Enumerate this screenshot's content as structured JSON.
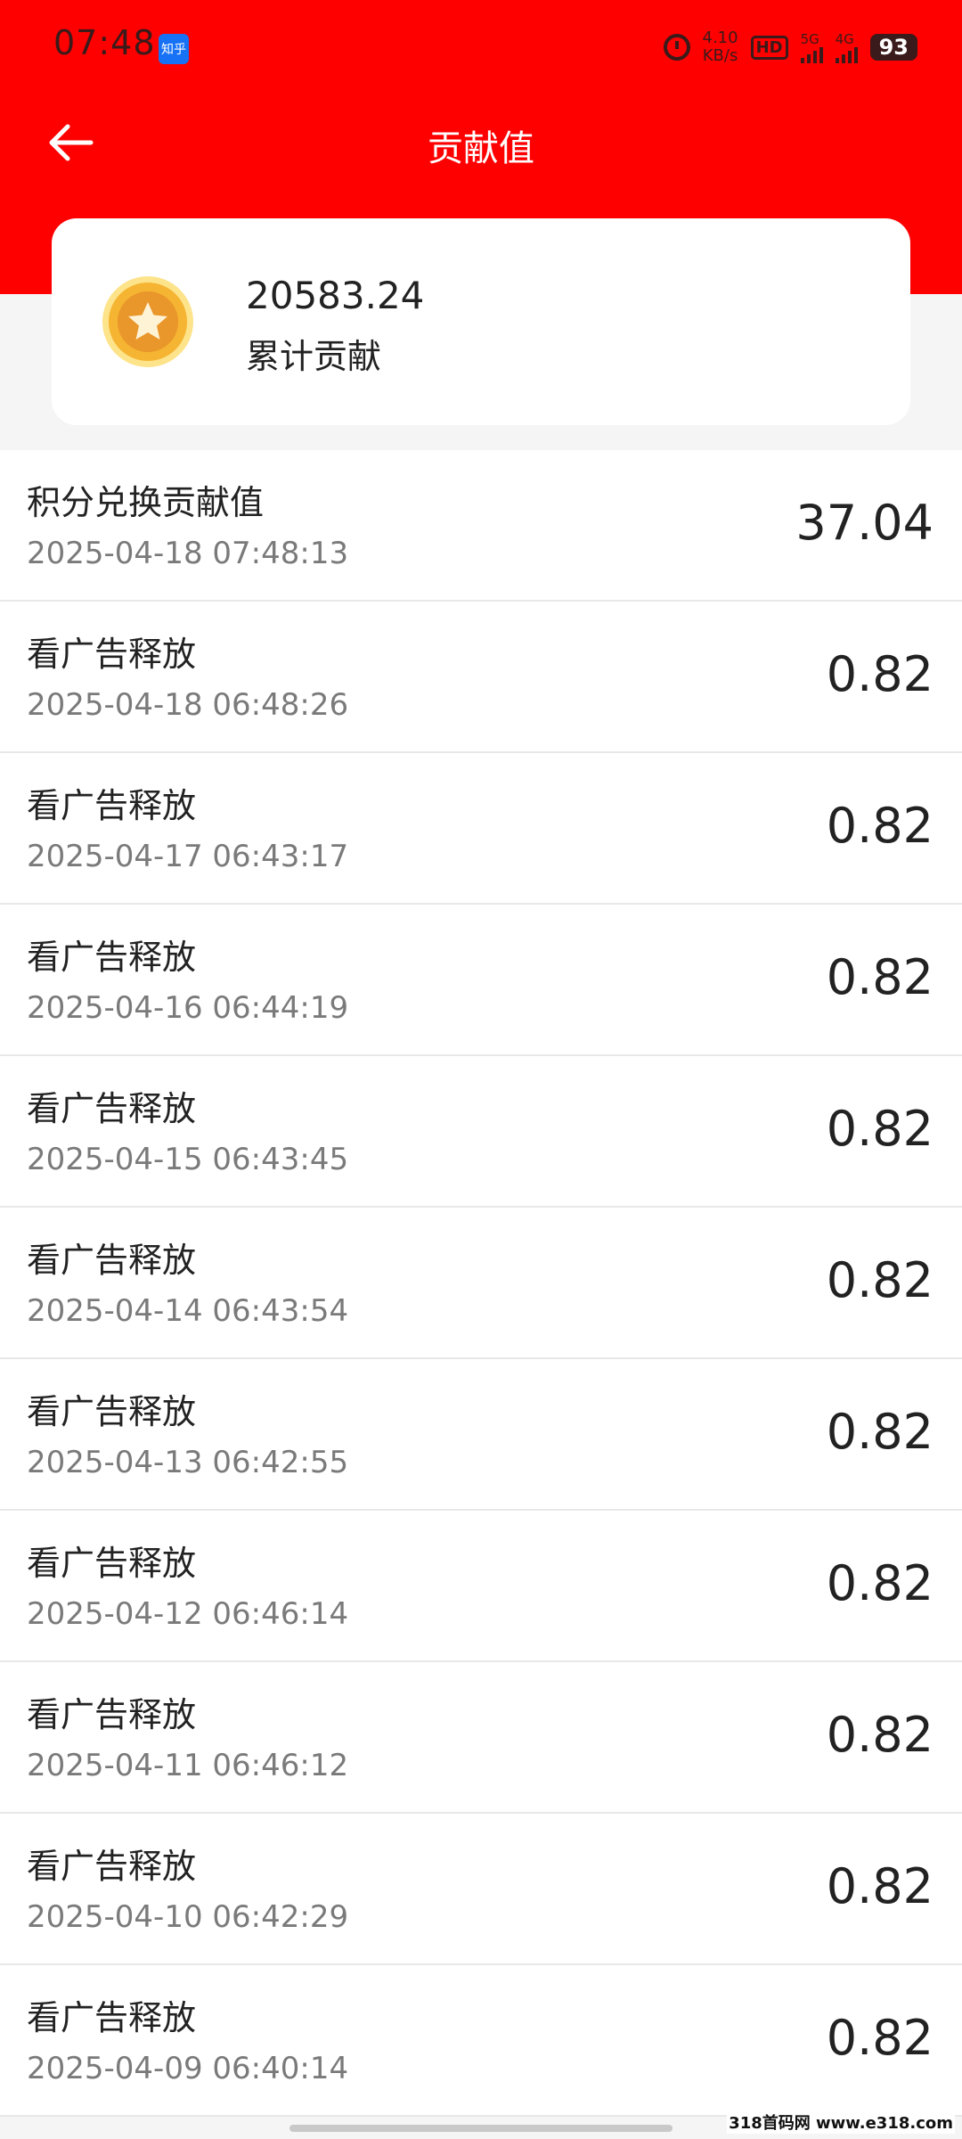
{
  "status_bar": {
    "time": "07:48",
    "app_icon_text": "知乎",
    "net_speed_value": "4.10",
    "net_speed_unit": "KB/s",
    "hd_label": "HD",
    "sim1_label": "5G",
    "sim2_label": "4G",
    "battery": "93"
  },
  "header": {
    "title": "贡献值"
  },
  "summary": {
    "value": "20583.24",
    "label": "累计贡献"
  },
  "records": [
    {
      "label": "积分兑换贡献值",
      "date": "2025-04-18 07:48:13",
      "amount": "37.04"
    },
    {
      "label": "看广告释放",
      "date": "2025-04-18 06:48:26",
      "amount": "0.82"
    },
    {
      "label": "看广告释放",
      "date": "2025-04-17 06:43:17",
      "amount": "0.82"
    },
    {
      "label": "看广告释放",
      "date": "2025-04-16 06:44:19",
      "amount": "0.82"
    },
    {
      "label": "看广告释放",
      "date": "2025-04-15 06:43:45",
      "amount": "0.82"
    },
    {
      "label": "看广告释放",
      "date": "2025-04-14 06:43:54",
      "amount": "0.82"
    },
    {
      "label": "看广告释放",
      "date": "2025-04-13 06:42:55",
      "amount": "0.82"
    },
    {
      "label": "看广告释放",
      "date": "2025-04-12 06:46:14",
      "amount": "0.82"
    },
    {
      "label": "看广告释放",
      "date": "2025-04-11 06:46:12",
      "amount": "0.82"
    },
    {
      "label": "看广告释放",
      "date": "2025-04-10 06:42:29",
      "amount": "0.82"
    },
    {
      "label": "看广告释放",
      "date": "2025-04-09 06:40:14",
      "amount": "0.82"
    }
  ],
  "watermark": "318首码网 www.e318.com",
  "colors": {
    "header_red": "#ff0000",
    "page_bg": "#f5f5f5",
    "coin_gold": "#f5b431"
  },
  "icons": {
    "back": "arrow-left-icon",
    "coin": "star-coin-icon"
  }
}
